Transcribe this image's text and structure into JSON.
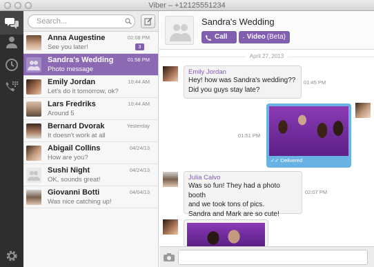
{
  "window": {
    "title": "Viber – +12125551234"
  },
  "search": {
    "placeholder": "Search..."
  },
  "conversations": [
    {
      "name": "Anna Augestine",
      "preview": "See you later!",
      "time": "02:08 PM",
      "badge": "3"
    },
    {
      "name": "Sandra's Wedding",
      "preview": "Photo message",
      "time": "01:58 PM",
      "selected": true
    },
    {
      "name": "Emily Jordan",
      "preview": "Let's do it tomorrow, ok?",
      "time": "10:44 AM"
    },
    {
      "name": "Lars Fredriks",
      "preview": "Around 5",
      "time": "10:44 AM"
    },
    {
      "name": "Bernard Dvorak",
      "preview": "It doesn't work at all",
      "time": "Yesterday"
    },
    {
      "name": "Abigail Collins",
      "preview": "How are you?",
      "time": "04/24/13"
    },
    {
      "name": "Sushi Night",
      "preview": "OK, sounds great!",
      "time": "04/24/13"
    },
    {
      "name": "Giovanni Botti",
      "preview": "Was nice catching up!",
      "time": "04/04/13"
    }
  ],
  "chat": {
    "title": "Sandra's Wedding",
    "call_label": "Call",
    "video_label": "Video",
    "video_beta": "(Beta)",
    "date": "April 27, 2013",
    "messages": [
      {
        "sender": "Emily Jordan",
        "text": "Hey! how was Sandra's wedding??\nDid you guys stay late?",
        "time": "01:45 PM"
      },
      {
        "type": "photo-outgoing",
        "time": "01:51 PM",
        "status": "Delivered"
      },
      {
        "sender": "Julia Calvo",
        "text": "Was so fun! They had a photo booth\nand we took tons of pics.\nSandra and Mark are so cute!",
        "time": "02:07 PM"
      },
      {
        "type": "photo-incoming"
      }
    ]
  },
  "colors": {
    "accent": "#7f5fae",
    "selected": "#8b6ab3",
    "rail": "#2e2e2e",
    "delivered_bubble": "#68b3e4"
  },
  "icons": [
    "chat-bubbles-icon",
    "contacts-icon",
    "recents-clock-icon",
    "keypad-icon",
    "settings-gear-icon",
    "search-icon",
    "compose-icon",
    "phone-icon",
    "video-camera-icon",
    "camera-icon"
  ]
}
